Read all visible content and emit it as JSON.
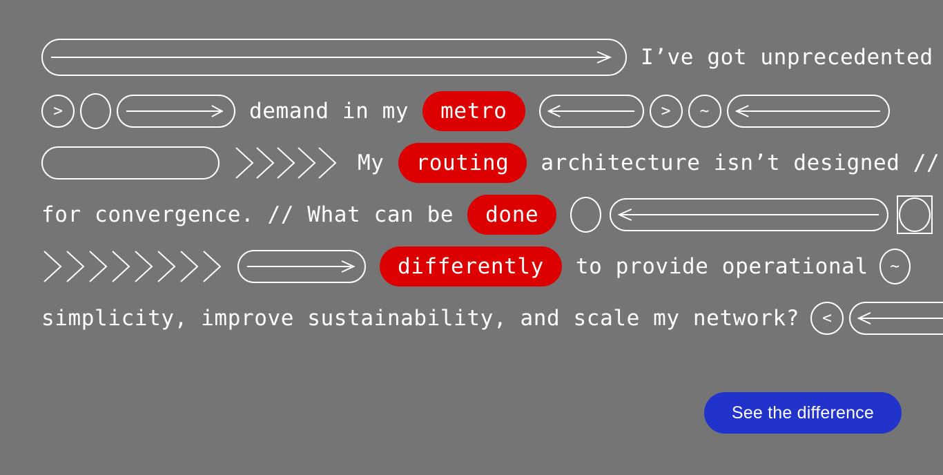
{
  "theme": {
    "background": "#757575",
    "stroke": "#ffffff",
    "highlight": "#dc0000",
    "cta_background": "#2233cc",
    "cta_text": "#ffffff"
  },
  "headline": {
    "full_text": "I've got unprecedented demand in my metro // My routing architecture isn't designed // for convergence. // What can be done differently to provide operational simplicity, improve sustainability, and scale my network?",
    "lines": [
      {
        "id": "line-1",
        "text": "I’ve got unprecedented"
      },
      {
        "id": "line-2a",
        "text": "demand in my"
      },
      {
        "id": "line-2b_highlight",
        "text": "metro"
      },
      {
        "id": "line-3a",
        "text": "My"
      },
      {
        "id": "line-3b_highlight",
        "text": "routing"
      },
      {
        "id": "line-3c",
        "text": "architecture isn’t designed //"
      },
      {
        "id": "line-4a",
        "text": "for convergence. // What can be"
      },
      {
        "id": "line-4b_highlight",
        "text": "done"
      },
      {
        "id": "line-5a_highlight",
        "text": "differently"
      },
      {
        "id": "line-5b",
        "text": "to provide operational"
      },
      {
        "id": "line-6",
        "text": "simplicity, improve sustainability, and scale my network?"
      }
    ]
  },
  "glyphs": {
    "chevron_right": ">",
    "tilde": "~",
    "chevron_left": "<"
  },
  "decor": {
    "row1": [
      "pill-right-arrow-long"
    ],
    "row2": [
      "circle-chevron-right",
      "ellipse-empty",
      "pill-right-arrow",
      "pill-left-arrow",
      "circle-chevron-right",
      "circle-tilde",
      "pill-left-arrow-long"
    ],
    "row3": [
      "pill-empty",
      "chevron-run-5"
    ],
    "row4": [
      "ellipse-empty",
      "pill-left-arrow-long",
      "square-with-circle"
    ],
    "row5": [
      "chevron-run-8",
      "pill-right-arrow",
      "ellipse-tilde"
    ],
    "row6": [
      "circle-chevron-left",
      "pill-left-arrow"
    ]
  },
  "cta": {
    "label": "See the difference"
  }
}
